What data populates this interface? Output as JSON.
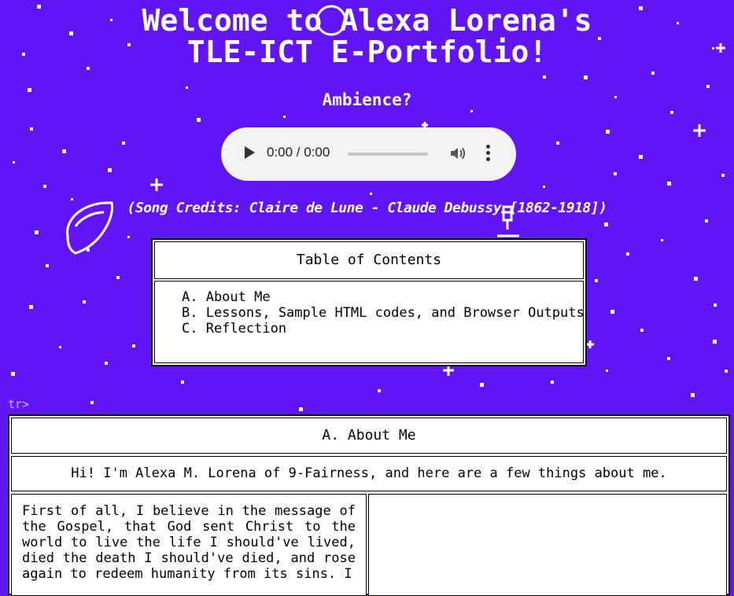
{
  "header": {
    "title_line1": "Welcome to Alexa Lorena's",
    "title_line2": "TLE-ICT E-Portfolio!"
  },
  "ambience": {
    "label": "Ambience?"
  },
  "audio_player": {
    "time": "0:00 / 0:00",
    "progress": 0
  },
  "credits": "(Song Credits: Claire de Lune - Claude Debussy [1862-1918])",
  "toc": {
    "title": "Table of Contents",
    "items": [
      "A. About Me",
      "B. Lessons, Sample HTML codes, and Browser Outputs",
      "C. Reflection"
    ]
  },
  "stray_text": "tr>",
  "about": {
    "heading": "A. About Me",
    "intro": "Hi! I'm Alexa M. Lorena of 9-Fairness, and here are a few things about me.",
    "paragraph": "First of all, I believe in the message of the Gospel, that God sent Christ to the world to live the life I should've lived, died the death I should've died, and rose again to redeem humanity from its sins. I"
  },
  "colors": {
    "background": "#6214f5",
    "text_light": "#ffffff",
    "panel": "#ffffff"
  }
}
